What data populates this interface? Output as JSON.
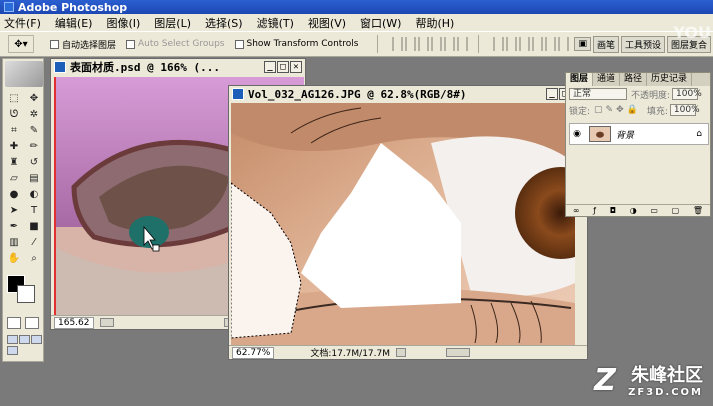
{
  "app": {
    "title": "Adobe Photoshop"
  },
  "menu": [
    "文件(F)",
    "编辑(E)",
    "图像(I)",
    "图层(L)",
    "选择(S)",
    "滤镜(T)",
    "视图(V)",
    "窗口(W)",
    "帮助(H)"
  ],
  "options": {
    "auto_select_layer": "自动选择图层",
    "auto_select_groups": "Auto Select Groups",
    "show_transform_controls": "Show Transform Controls"
  },
  "palette_well": [
    "画笔",
    "工具预设",
    "图层复合"
  ],
  "doc1": {
    "title": "表面材质.psd @ 166% (...",
    "zoom": "165.62"
  },
  "doc2": {
    "title": "Vol_032_AG126.JPG @ 62.8%(RGB/8#)",
    "zoom": "62.77%",
    "doc_size": "文档:17.7M/17.7M"
  },
  "layers_panel": {
    "tabs": [
      "图层",
      "通道",
      "路径",
      "历史记录"
    ],
    "blend_mode": "正常",
    "opacity_label": "不透明度:",
    "opacity_value": "100%",
    "lock_label": "锁定:",
    "fill_label": "填充:",
    "fill_value": "100%",
    "layer_name": "背景"
  },
  "watermark": {
    "logo": "Z",
    "cn": "朱峰社区",
    "en": "ZF3D.COM",
    "yt": "YOU"
  },
  "colors": {
    "titlebar": "#1d47b3",
    "chrome": "#ece9d8",
    "workspace": "#7a7a7a"
  }
}
